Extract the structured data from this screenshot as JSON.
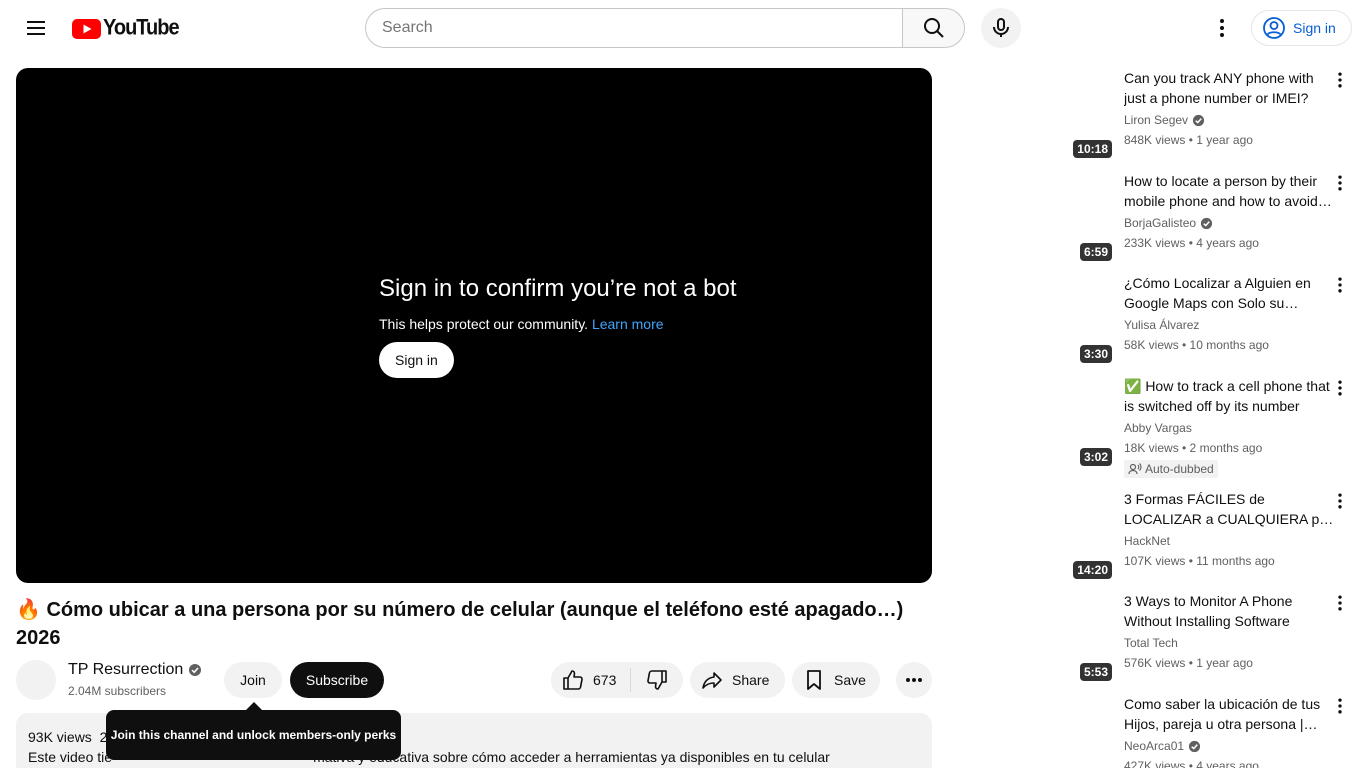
{
  "header": {
    "logo_text": "YouTube",
    "search_placeholder": "Search",
    "signin_label": "Sign in"
  },
  "player": {
    "bot_title": "Sign in to confirm you’re not a bot",
    "bot_subtitle": "This helps protect our community.",
    "learn_more": "Learn more",
    "signin_label": "Sign in"
  },
  "video": {
    "title_emoji": "🔥",
    "title": "Cómo ubicar a una persona por su número de celular (aunque el teléfono esté apagado…) 2026",
    "channel": "TP Resurrection",
    "subscribers": "2.04M subscribers",
    "join_label": "Join",
    "subscribe_label": "Subscribe",
    "likes": "673",
    "share_label": "Share",
    "save_label": "Save",
    "tooltip": "Join this channel and unlock members-only perks",
    "views": "93K views",
    "views_suffix": "2",
    "desc_start": "Este video tie",
    "desc_end": "mativa y educativa sobre cómo acceder a herramientas ya disponibles en tu celular"
  },
  "related": [
    {
      "title": "Can you track ANY phone with just a phone number or IMEI?",
      "channel": "Liron Segev",
      "verified": true,
      "meta": "848K views • 1 year ago",
      "duration": "10:18"
    },
    {
      "title": "How to locate a person by their mobile phone and how to avoid being located",
      "channel": "BorjaGalisteo",
      "verified": true,
      "meta": "233K views • 4 years ago",
      "duration": "6:59"
    },
    {
      "title": "¿Cómo Localizar a Alguien en Google Maps con Solo su Número?",
      "channel": "Yulisa Álvarez",
      "verified": false,
      "meta": "58K views • 10 months ago",
      "duration": "3:30"
    },
    {
      "title": "✅ How to track a cell phone that is switched off by its number",
      "channel": "Abby Vargas",
      "verified": false,
      "meta": "18K views • 2 months ago",
      "duration": "3:02",
      "badge": "Auto-dubbed"
    },
    {
      "title": "3 Formas FÁCILES de LOCALIZAR a CUALQUIERA por su número",
      "channel": "HackNet",
      "verified": false,
      "meta": "107K views • 11 months ago",
      "duration": "14:20"
    },
    {
      "title": "3 Ways to Monitor A Phone Without Installing Software",
      "channel": "Total Tech",
      "verified": false,
      "meta": "576K views • 1 year ago",
      "duration": "5:53"
    },
    {
      "title": "Como saber la ubicación de tus Hijos, pareja u otra persona | Tutorial",
      "channel": "NeoArca01",
      "verified": true,
      "meta": "427K views • 4 years ago",
      "duration": ""
    }
  ],
  "colors": {
    "accent_red": "#ff0000",
    "link_blue": "#065fd4",
    "player_link": "#3ea6ff"
  }
}
